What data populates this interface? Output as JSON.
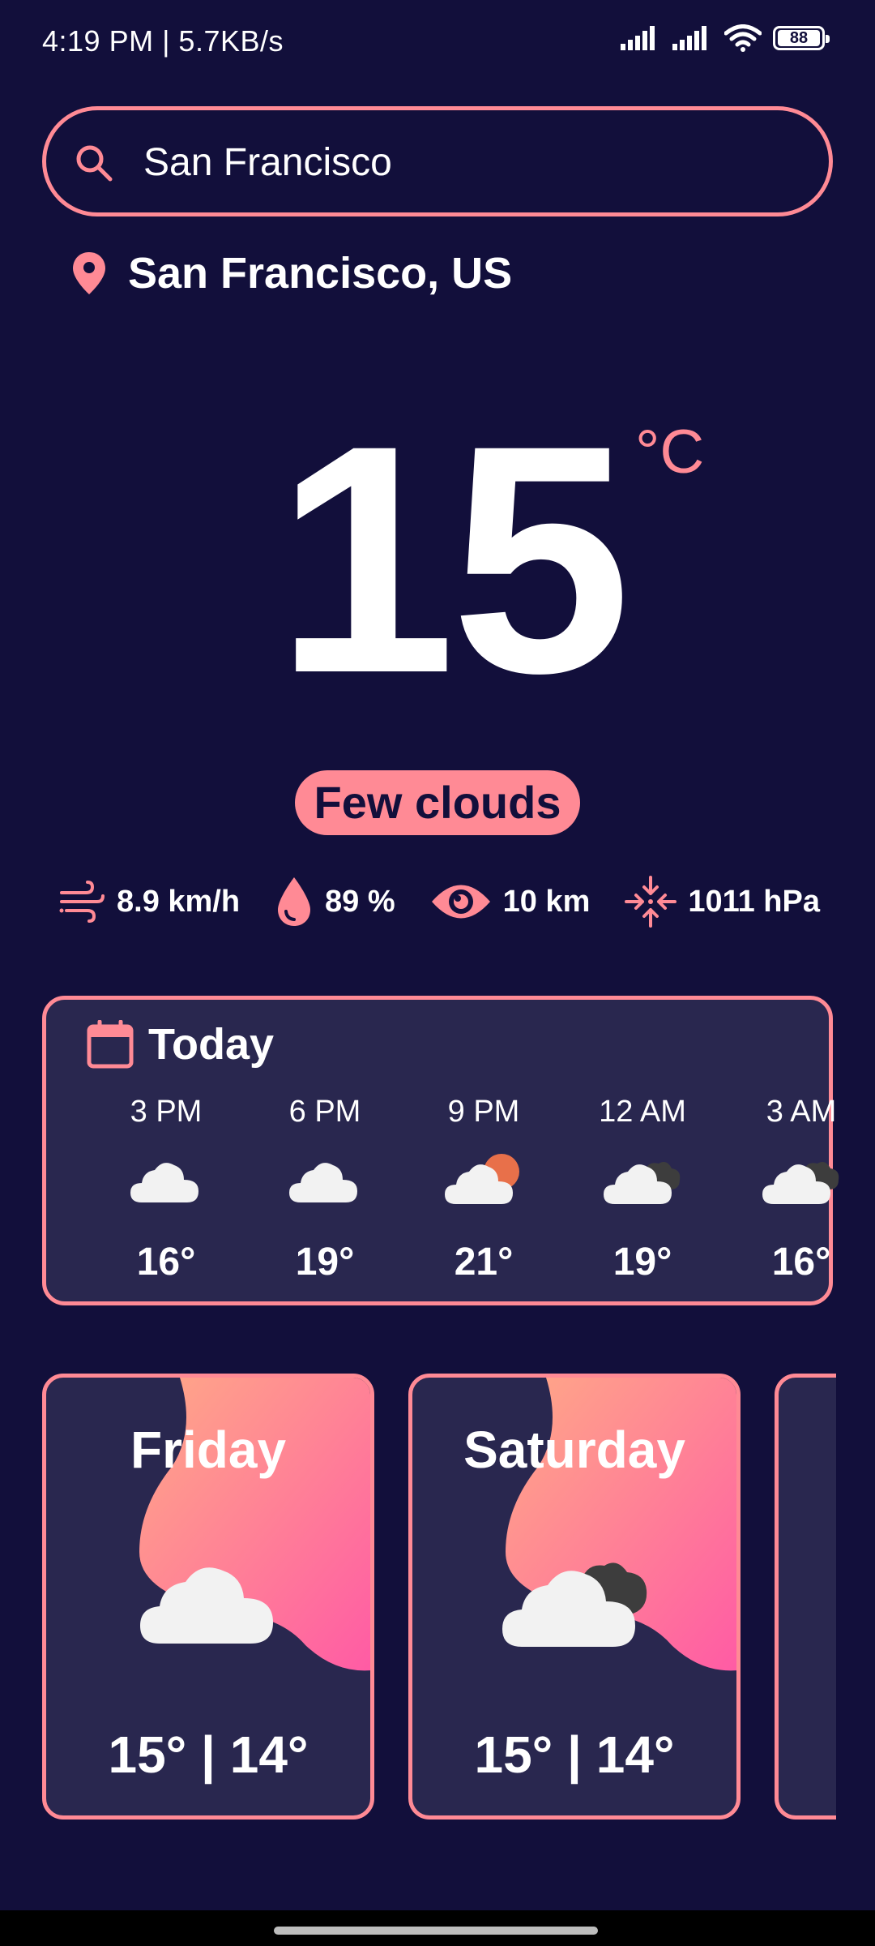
{
  "status_bar": {
    "time_speed": "4:19 PM | 5.7KB/s",
    "battery": "88",
    "icons": [
      "signal-icon",
      "signal-icon",
      "wifi-icon",
      "battery-icon"
    ]
  },
  "search": {
    "value": "San Francisco",
    "placeholder": ""
  },
  "location": {
    "label": "San Francisco, US",
    "icon": "location-pin-icon"
  },
  "current": {
    "temperature": "15",
    "unit": "°C",
    "condition": "Few clouds"
  },
  "stats": [
    {
      "icon": "wind-icon",
      "value": "8.9 km/h"
    },
    {
      "icon": "humidity-icon",
      "value": "89 %"
    },
    {
      "icon": "visibility-icon",
      "value": "10 km"
    },
    {
      "icon": "pressure-icon",
      "value": "1011 hPa"
    }
  ],
  "today": {
    "title": "Today",
    "icon": "calendar-icon",
    "hours": [
      {
        "time": "3 PM",
        "icon": "cloud-icon",
        "temp": "16°"
      },
      {
        "time": "6 PM",
        "icon": "cloud-icon",
        "temp": "19°"
      },
      {
        "time": "9 PM",
        "icon": "sun-cloud-icon",
        "temp": "21°"
      },
      {
        "time": "12 AM",
        "icon": "dark-cloud-icon",
        "temp": "19°"
      },
      {
        "time": "3 AM",
        "icon": "dark-cloud-icon",
        "temp": "16°"
      }
    ]
  },
  "forecast": [
    {
      "day": "Friday",
      "icon": "cloud-icon",
      "temps": "15° | 14°"
    },
    {
      "day": "Saturday",
      "icon": "dark-cloud-icon",
      "temps": "15° | 14°"
    }
  ],
  "colors": {
    "background": "#120f3b",
    "card": "#29274f",
    "accent": "#ff8a95",
    "gradient_start": "#ffa987",
    "gradient_end": "#ff5aa5"
  }
}
